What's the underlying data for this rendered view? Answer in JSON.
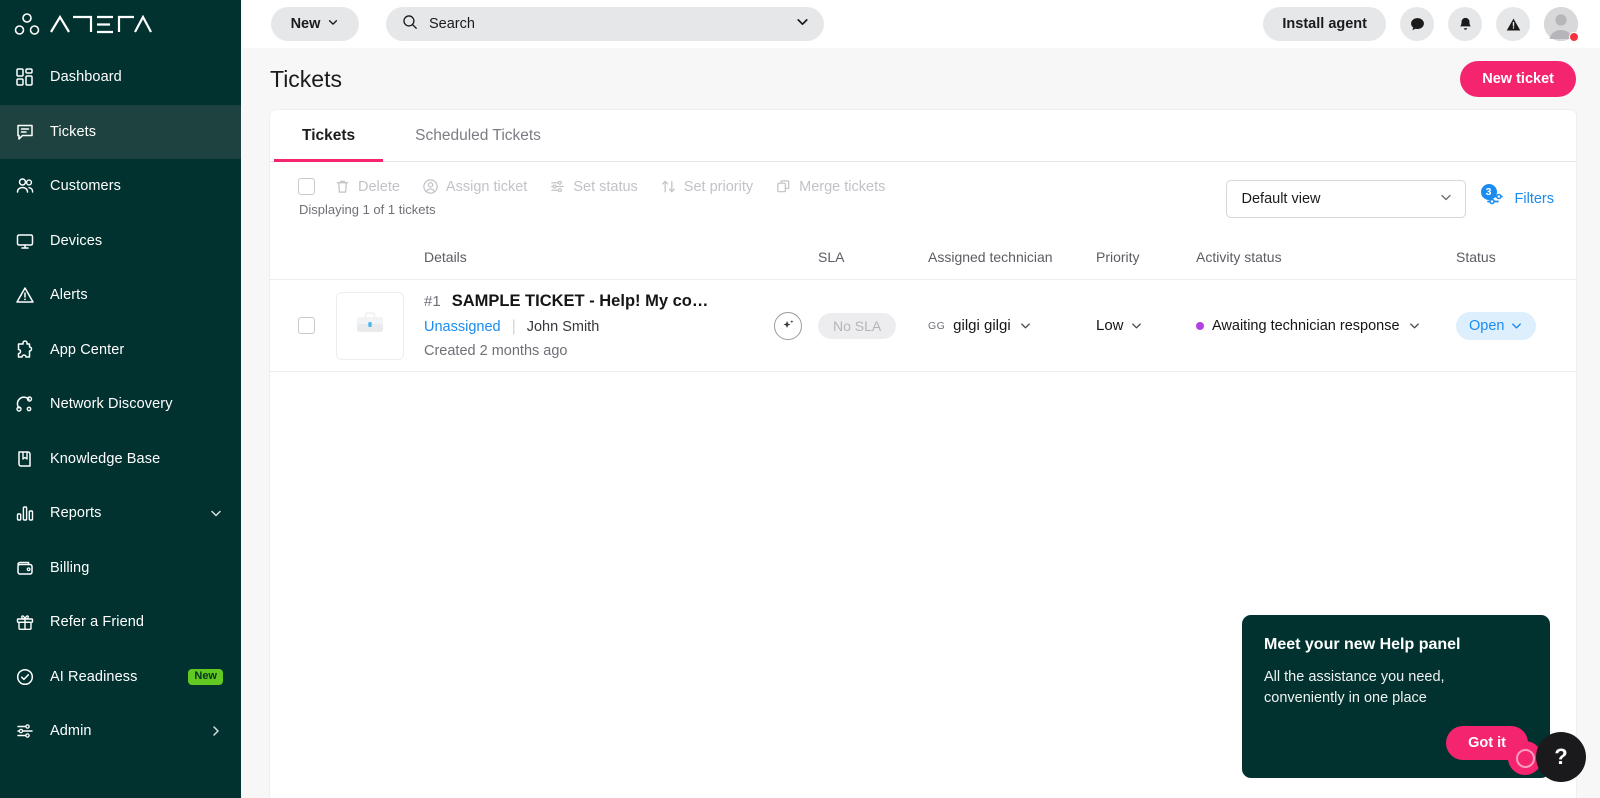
{
  "brand": {
    "name": "ATERA",
    "sidebar_bg": "#01322F",
    "sidebar_active_bg": "#1D423F",
    "accent_pink": "#F4246E",
    "accent_blue": "#1A8CF0",
    "badge_green": "#62C822"
  },
  "sidebar": {
    "items": [
      {
        "label": "Dashboard",
        "icon": "dashboard-icon",
        "active": false
      },
      {
        "label": "Tickets",
        "icon": "ticket-chat-icon",
        "active": true
      },
      {
        "label": "Customers",
        "icon": "customers-icon",
        "active": false
      },
      {
        "label": "Devices",
        "icon": "devices-icon",
        "active": false
      },
      {
        "label": "Alerts",
        "icon": "alert-triangle-icon",
        "active": false
      },
      {
        "label": "App Center",
        "icon": "puzzle-icon",
        "active": false
      },
      {
        "label": "Network Discovery",
        "icon": "network-discovery-icon",
        "active": false
      },
      {
        "label": "Knowledge Base",
        "icon": "book-icon",
        "active": false
      },
      {
        "label": "Reports",
        "icon": "bar-chart-icon",
        "active": false,
        "chevron": "chevron-down-icon"
      },
      {
        "label": "Billing",
        "icon": "wallet-icon",
        "active": false
      },
      {
        "label": "Refer a Friend",
        "icon": "gift-icon",
        "active": false
      },
      {
        "label": "AI Readiness",
        "icon": "check-circle-icon",
        "active": false,
        "badge": "New"
      },
      {
        "label": "Admin",
        "icon": "sliders-icon",
        "active": false,
        "chevron": "chevron-right-icon"
      }
    ]
  },
  "topbar": {
    "new_label": "New",
    "search_placeholder": "Search",
    "search_value": "",
    "install_agent_label": "Install agent",
    "icons": [
      "chat-icon",
      "bell-icon",
      "alert-icon",
      "avatar"
    ]
  },
  "page": {
    "title": "Tickets",
    "new_ticket_label": "New ticket"
  },
  "tabs": [
    {
      "label": "Tickets",
      "active": true
    },
    {
      "label": "Scheduled Tickets",
      "active": false
    }
  ],
  "toolbar": {
    "actions": [
      {
        "label": "Delete",
        "icon": "trash-icon",
        "disabled": true
      },
      {
        "label": "Assign ticket",
        "icon": "user-circle-icon",
        "disabled": true
      },
      {
        "label": "Set status",
        "icon": "sliders-icon",
        "disabled": true
      },
      {
        "label": "Set priority",
        "icon": "sort-arrows-icon",
        "disabled": true
      },
      {
        "label": "Merge tickets",
        "icon": "merge-icon",
        "disabled": true
      }
    ],
    "displaying": "Displaying 1 of 1 tickets",
    "view_selected": "Default view",
    "filters_label": "Filters",
    "filters_count": "3"
  },
  "table": {
    "columns": [
      "Details",
      "SLA",
      "Assigned technician",
      "Priority",
      "Activity status",
      "Status"
    ],
    "rows": [
      {
        "selected": false,
        "thumb_icon": "briefcase-icon",
        "number": "#1",
        "title": "SAMPLE TICKET - Help! My co…",
        "assignee": "Unassigned",
        "customer": "John Smith",
        "created": "Created 2 months ago",
        "ai_action": "ai-sparkle-button",
        "sla": "No SLA",
        "technician_initials": "GG",
        "technician": "gilgi gilgi",
        "priority": "Low",
        "activity_status": "Awaiting technician response",
        "activity_status_color": "#B341E0",
        "status": "Open"
      }
    ]
  },
  "help_tooltip": {
    "title": "Meet your new Help panel",
    "body": "All the assistance you need, conveniently in one place",
    "cta": "Got it"
  },
  "help_fab": {
    "glyph": "?"
  }
}
